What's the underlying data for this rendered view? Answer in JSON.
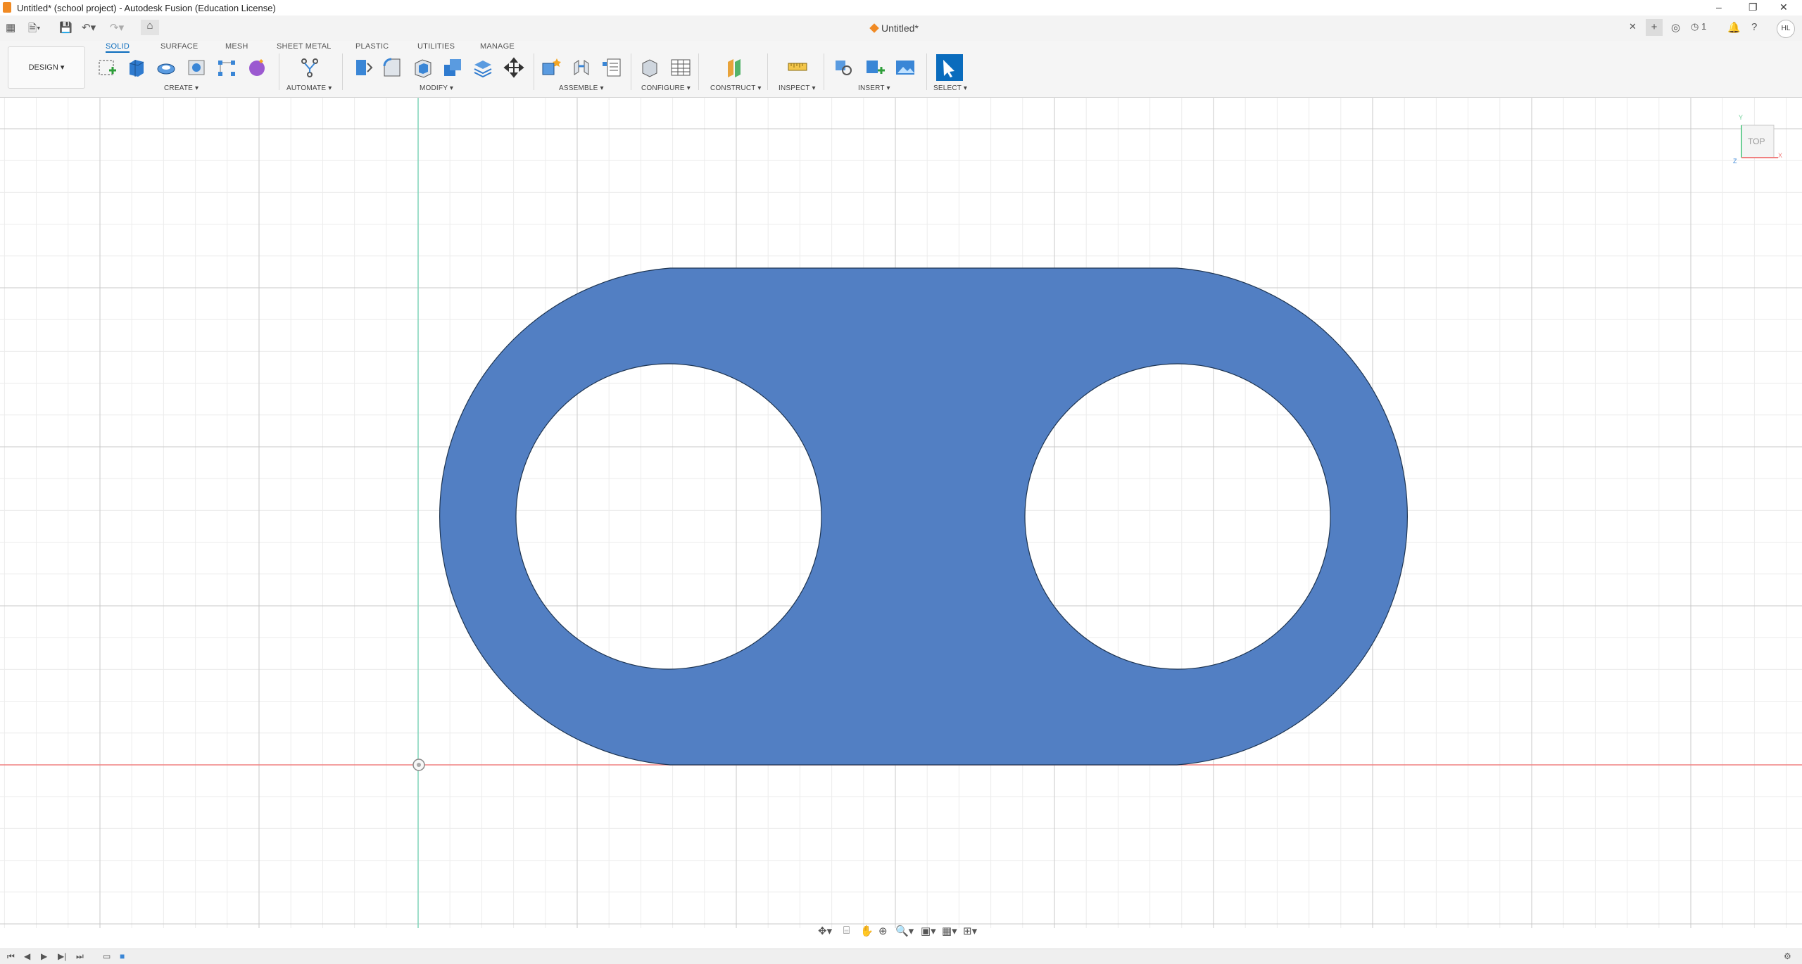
{
  "window": {
    "title": "Untitled* (school project) - Autodesk Fusion (Education License)",
    "minimize": "–",
    "maximize": "❐",
    "close": "✕"
  },
  "quick_access": {
    "data_panel_icon": "grid-icon",
    "file_icon": "file-icon",
    "save_icon": "save-icon",
    "undo_icon": "undo-icon",
    "redo_icon": "redo-icon",
    "home_icon": "home-icon"
  },
  "document_tab": {
    "label": "Untitled*",
    "close": "✕"
  },
  "right_bar": {
    "job_count": "1",
    "user_initials": "HL"
  },
  "workspace": {
    "label": "DESIGN ▾"
  },
  "tabs": [
    "SOLID",
    "SURFACE",
    "MESH",
    "SHEET METAL",
    "PLASTIC",
    "UTILITIES",
    "MANAGE"
  ],
  "active_tab": "SOLID",
  "groups": {
    "create": "CREATE ▾",
    "automate": "AUTOMATE ▾",
    "modify": "MODIFY ▾",
    "assemble": "ASSEMBLE ▾",
    "configure": "CONFIGURE ▾",
    "construct": "CONSTRUCT ▾",
    "inspect": "INSPECT ▾",
    "insert": "INSERT ▾",
    "select": "SELECT ▾"
  },
  "viewcube": {
    "face": "TOP",
    "axis_y": "Y",
    "axis_x": "X",
    "axis_z": "Z"
  },
  "colors": {
    "body_fill": "#527fc3",
    "body_stroke": "#1e3552",
    "accent": "#0a6cbd",
    "x_axis": "#f08080",
    "y_axis": "#7fd3b8"
  }
}
